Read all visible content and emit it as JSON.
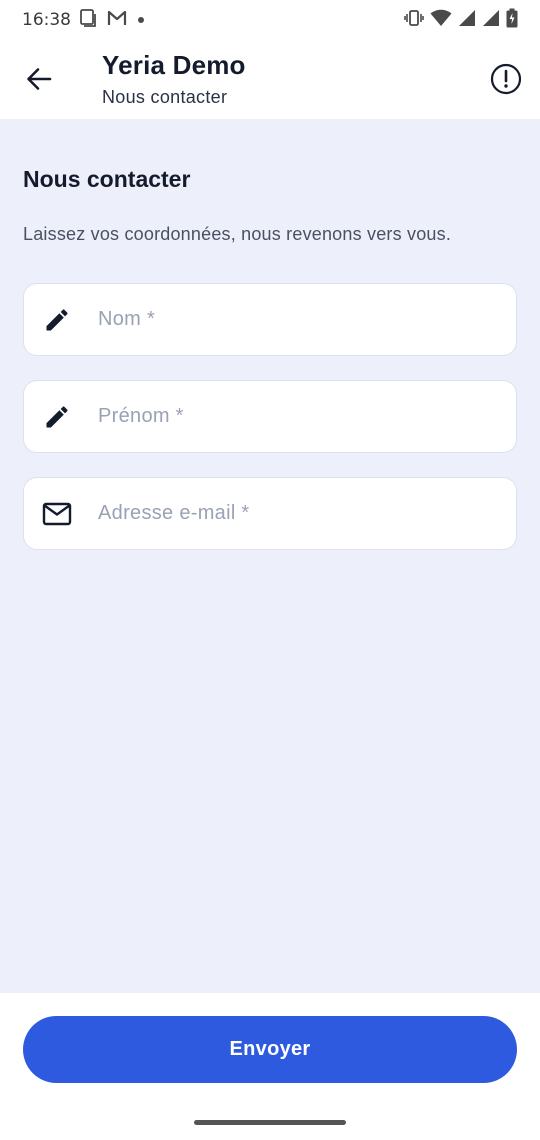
{
  "status_bar": {
    "time": "16:38",
    "icons": [
      "screenshot-icon",
      "gmail-icon",
      "dot-icon",
      "vibrate-icon",
      "wifi-icon",
      "signal-icon",
      "signal-icon",
      "battery-icon"
    ]
  },
  "app_bar": {
    "title": "Yeria Demo",
    "subtitle": "Nous contacter",
    "back_icon": "arrow-left-icon",
    "info_icon": "info-icon"
  },
  "content": {
    "heading": "Nous contacter",
    "description": "Laissez vos coordonnées, nous revenons vers vous."
  },
  "form": {
    "fields": [
      {
        "icon": "pencil-icon",
        "value": "",
        "placeholder": "Nom *"
      },
      {
        "icon": "pencil-icon",
        "value": "",
        "placeholder": "Prénom *"
      },
      {
        "icon": "mail-icon",
        "value": "",
        "placeholder": "Adresse e-mail *"
      }
    ],
    "submit_label": "Envoyer"
  },
  "colors": {
    "background": "#edf0fb",
    "primary": "#2e5ae0",
    "text_dark": "#141b2d"
  }
}
